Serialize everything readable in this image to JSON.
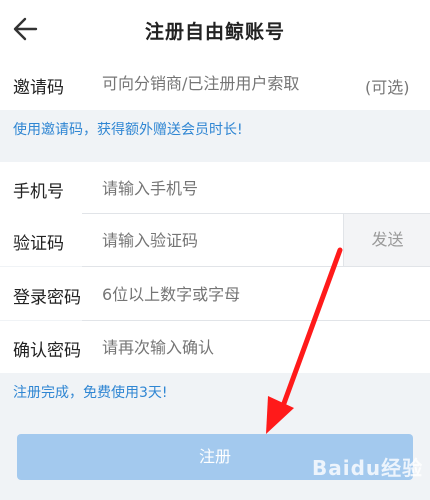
{
  "header": {
    "title": "注册自由鲸账号",
    "back_icon": "arrow-left-icon"
  },
  "invite": {
    "label": "邀请码",
    "placeholder": "可向分销商/已注册用户索取",
    "optional": "(可选)",
    "hint": "使用邀请码，获得额外赠送会员时长!"
  },
  "form": {
    "phone": {
      "label": "手机号",
      "placeholder": "请输入手机号"
    },
    "code": {
      "label": "验证码",
      "placeholder": "请输入验证码",
      "send_label": "发送"
    },
    "password": {
      "label": "登录密码",
      "placeholder": "6位以上数字或字母"
    },
    "confirm": {
      "label": "确认密码",
      "placeholder": "请再次输入确认"
    }
  },
  "bonus_hint": "注册完成，免费使用3天!",
  "submit_label": "注册",
  "watermark": "Baidu经验",
  "annotation": {
    "type": "red-arrow-icon",
    "color": "#ff1a1a"
  },
  "colors": {
    "accent": "#2f86d3",
    "button": "#a3c9ee",
    "background": "#f0f3f6"
  }
}
